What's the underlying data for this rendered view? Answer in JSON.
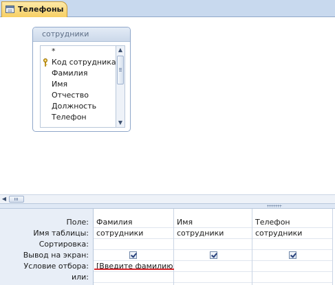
{
  "tab": {
    "title": "Телефоны",
    "icon": "query-icon"
  },
  "table_box": {
    "title": "сотрудники",
    "fields": [
      {
        "name": "*",
        "key": false
      },
      {
        "name": "Код сотрудника",
        "key": true
      },
      {
        "name": "Фамилия",
        "key": false
      },
      {
        "name": "Имя",
        "key": false
      },
      {
        "name": "Отчество",
        "key": false
      },
      {
        "name": "Должность",
        "key": false
      },
      {
        "name": "Телефон",
        "key": false
      }
    ]
  },
  "grid": {
    "row_labels": {
      "field": "Поле:",
      "table": "Имя таблицы:",
      "sort": "Сортировка:",
      "show": "Вывод на экран:",
      "criteria": "Условие отбора:",
      "or": "или:"
    },
    "columns": [
      {
        "field": "Фамилия",
        "table": "сотрудники",
        "sort": "",
        "show": true,
        "criteria": "[Введите фамилию]",
        "or": ""
      },
      {
        "field": "Имя",
        "table": "сотрудники",
        "sort": "",
        "show": true,
        "criteria": "",
        "or": ""
      },
      {
        "field": "Телефон",
        "table": "сотрудники",
        "sort": "",
        "show": true,
        "criteria": "",
        "or": ""
      }
    ]
  },
  "colors": {
    "tab_bg": "#f7cf63",
    "pane_header": "#dfe8f5",
    "criteria_highlight": "#d6252b"
  }
}
